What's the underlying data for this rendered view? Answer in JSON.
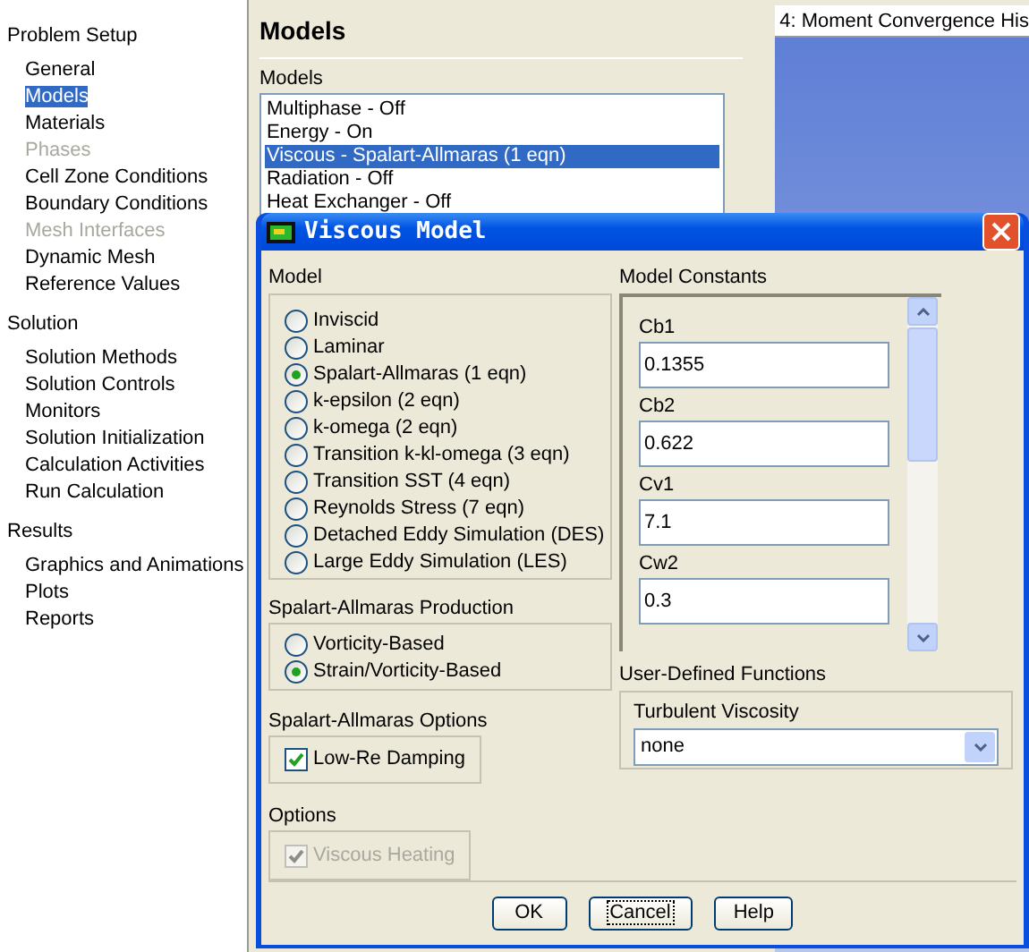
{
  "sidebar": {
    "sections": [
      {
        "title": "Problem Setup",
        "items": [
          {
            "label": "General",
            "selected": false,
            "disabled": false
          },
          {
            "label": "Models",
            "selected": true,
            "disabled": false
          },
          {
            "label": "Materials",
            "selected": false,
            "disabled": false
          },
          {
            "label": "Phases",
            "selected": false,
            "disabled": true
          },
          {
            "label": "Cell Zone Conditions",
            "selected": false,
            "disabled": false
          },
          {
            "label": "Boundary Conditions",
            "selected": false,
            "disabled": false
          },
          {
            "label": "Mesh Interfaces",
            "selected": false,
            "disabled": true
          },
          {
            "label": "Dynamic Mesh",
            "selected": false,
            "disabled": false
          },
          {
            "label": "Reference Values",
            "selected": false,
            "disabled": false
          }
        ]
      },
      {
        "title": "Solution",
        "items": [
          {
            "label": "Solution Methods",
            "selected": false,
            "disabled": false
          },
          {
            "label": "Solution Controls",
            "selected": false,
            "disabled": false
          },
          {
            "label": "Monitors",
            "selected": false,
            "disabled": false
          },
          {
            "label": "Solution Initialization",
            "selected": false,
            "disabled": false
          },
          {
            "label": "Calculation Activities",
            "selected": false,
            "disabled": false
          },
          {
            "label": "Run Calculation",
            "selected": false,
            "disabled": false
          }
        ]
      },
      {
        "title": "Results",
        "items": [
          {
            "label": "Graphics and Animations",
            "selected": false,
            "disabled": false
          },
          {
            "label": "Plots",
            "selected": false,
            "disabled": false
          },
          {
            "label": "Reports",
            "selected": false,
            "disabled": false
          }
        ]
      }
    ]
  },
  "panel": {
    "title": "Models",
    "list_label": "Models",
    "models": [
      {
        "label": "Multiphase - Off",
        "selected": false
      },
      {
        "label": "Energy - On",
        "selected": false
      },
      {
        "label": "Viscous - Spalart-Allmaras (1 eqn)",
        "selected": true
      },
      {
        "label": "Radiation - Off",
        "selected": false
      },
      {
        "label": "Heat Exchanger - Off",
        "selected": false
      }
    ]
  },
  "graphics": {
    "tab": "4: Moment Convergence His"
  },
  "dialog": {
    "title": "Viscous Model",
    "model": {
      "label": "Model",
      "options": [
        {
          "label": "Inviscid",
          "selected": false
        },
        {
          "label": "Laminar",
          "selected": false
        },
        {
          "label": "Spalart-Allmaras (1 eqn)",
          "selected": true
        },
        {
          "label": "k-epsilon (2 eqn)",
          "selected": false
        },
        {
          "label": "k-omega (2 eqn)",
          "selected": false
        },
        {
          "label": "Transition k-kl-omega (3 eqn)",
          "selected": false
        },
        {
          "label": "Transition SST (4 eqn)",
          "selected": false
        },
        {
          "label": "Reynolds Stress (7 eqn)",
          "selected": false
        },
        {
          "label": "Detached Eddy Simulation (DES)",
          "selected": false
        },
        {
          "label": "Large Eddy Simulation (LES)",
          "selected": false
        }
      ]
    },
    "production": {
      "label": "Spalart-Allmaras Production",
      "options": [
        {
          "label": "Vorticity-Based",
          "selected": false
        },
        {
          "label": "Strain/Vorticity-Based",
          "selected": true
        }
      ]
    },
    "sa_options": {
      "label": "Spalart-Allmaras Options",
      "items": [
        {
          "label": "Low-Re Damping",
          "checked": true,
          "disabled": false
        }
      ]
    },
    "options": {
      "label": "Options",
      "items": [
        {
          "label": "Viscous Heating",
          "checked": true,
          "disabled": true
        }
      ]
    },
    "constants": {
      "label": "Model Constants",
      "items": [
        {
          "label": "Cb1",
          "value": "0.1355"
        },
        {
          "label": "Cb2",
          "value": "0.622"
        },
        {
          "label": "Cv1",
          "value": "7.1"
        },
        {
          "label": "Cw2",
          "value": "0.3"
        }
      ]
    },
    "udf": {
      "label": "User-Defined Functions",
      "field_label": "Turbulent Viscosity",
      "value": "none"
    },
    "buttons": [
      {
        "label": "OK",
        "focused": false
      },
      {
        "label": "Cancel",
        "focused": true
      },
      {
        "label": "Help",
        "focused": false
      }
    ]
  }
}
